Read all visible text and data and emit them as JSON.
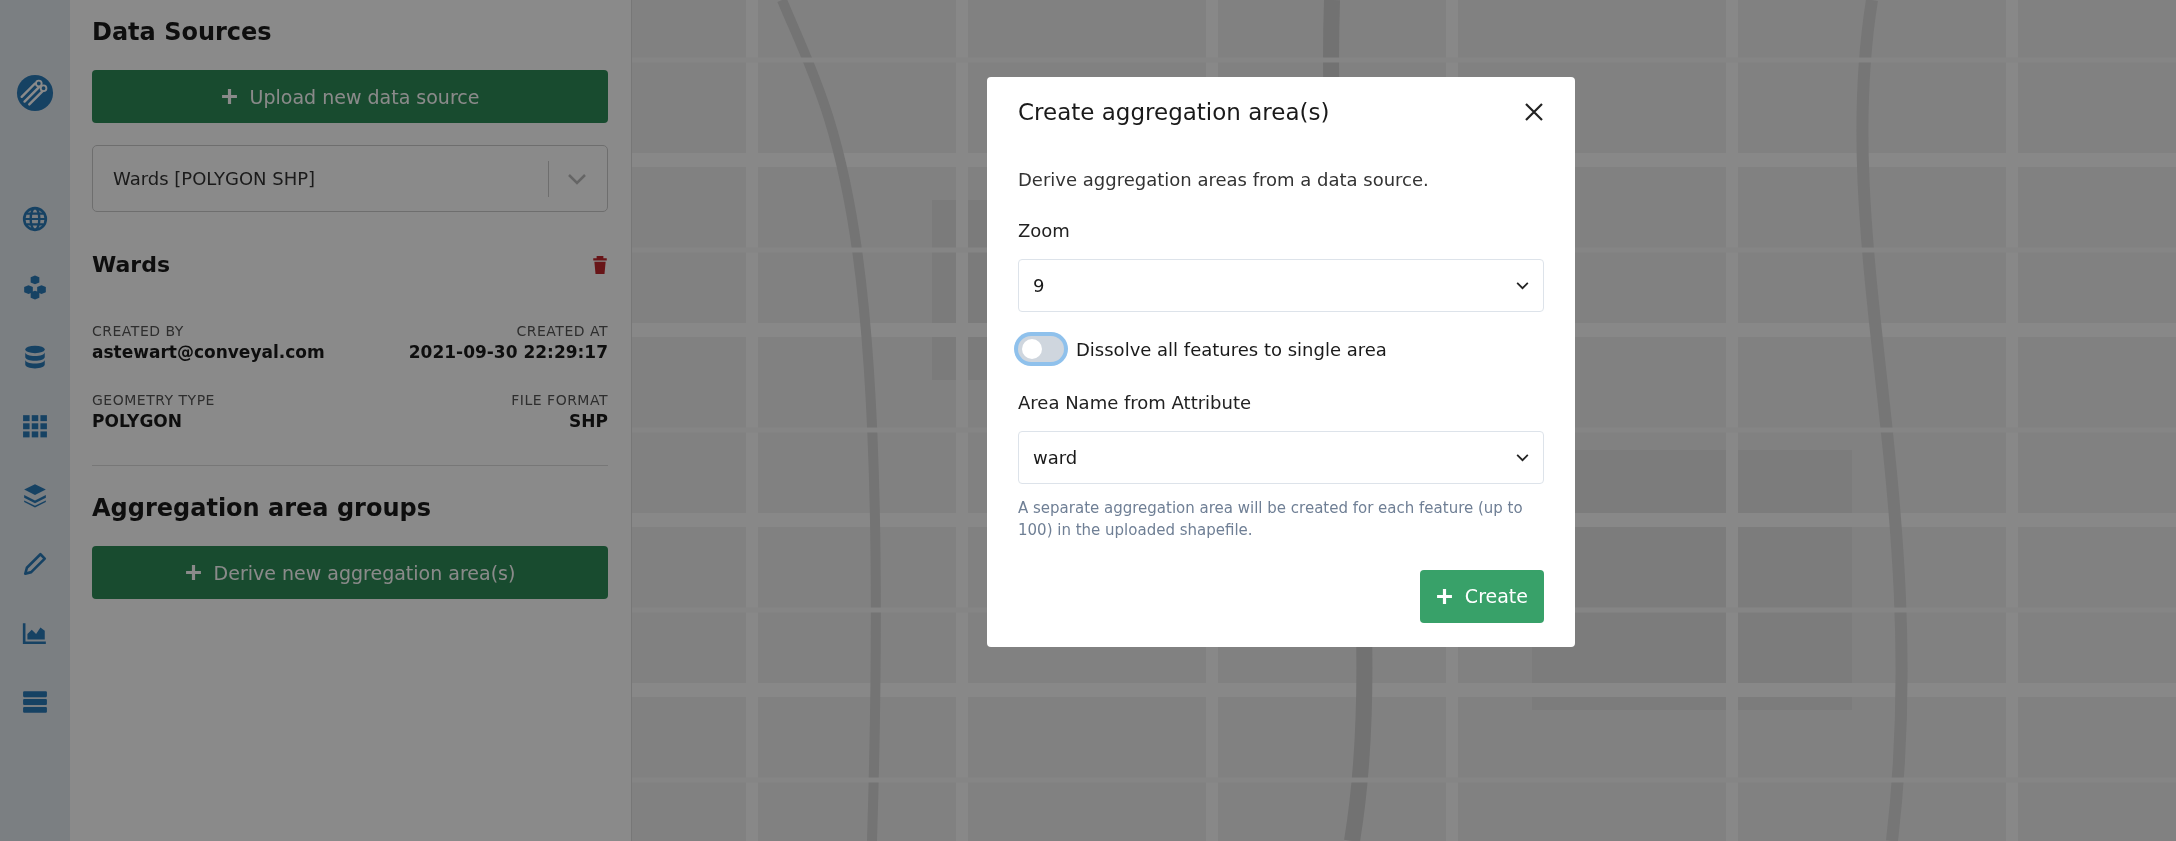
{
  "panel": {
    "title": "Data Sources",
    "upload_button": "Upload new data source",
    "source_select": {
      "value": "Wards [POLYGON SHP]"
    },
    "source": {
      "name": "Wards",
      "fields": [
        {
          "label": "CREATED BY",
          "value": "astewart@conveyal.com"
        },
        {
          "label": "CREATED AT",
          "value": "2021-09-30 22:29:17"
        },
        {
          "label": "GEOMETRY TYPE",
          "value": "POLYGON"
        },
        {
          "label": "FILE FORMAT",
          "value": "SHP"
        }
      ]
    },
    "groups_title": "Aggregation area groups",
    "derive_button": "Derive new aggregation area(s)"
  },
  "dialog": {
    "title": "Create aggregation area(s)",
    "description": "Derive aggregation areas from a data source.",
    "zoom": {
      "label": "Zoom",
      "value": "9"
    },
    "dissolve": {
      "label": "Dissolve all features to single area",
      "on": false
    },
    "attribute": {
      "label": "Area Name from Attribute",
      "value": "ward"
    },
    "help": "A separate aggregation area will be created for each feature (up to 100) in the uploaded shapefile.",
    "create_button": "Create"
  }
}
